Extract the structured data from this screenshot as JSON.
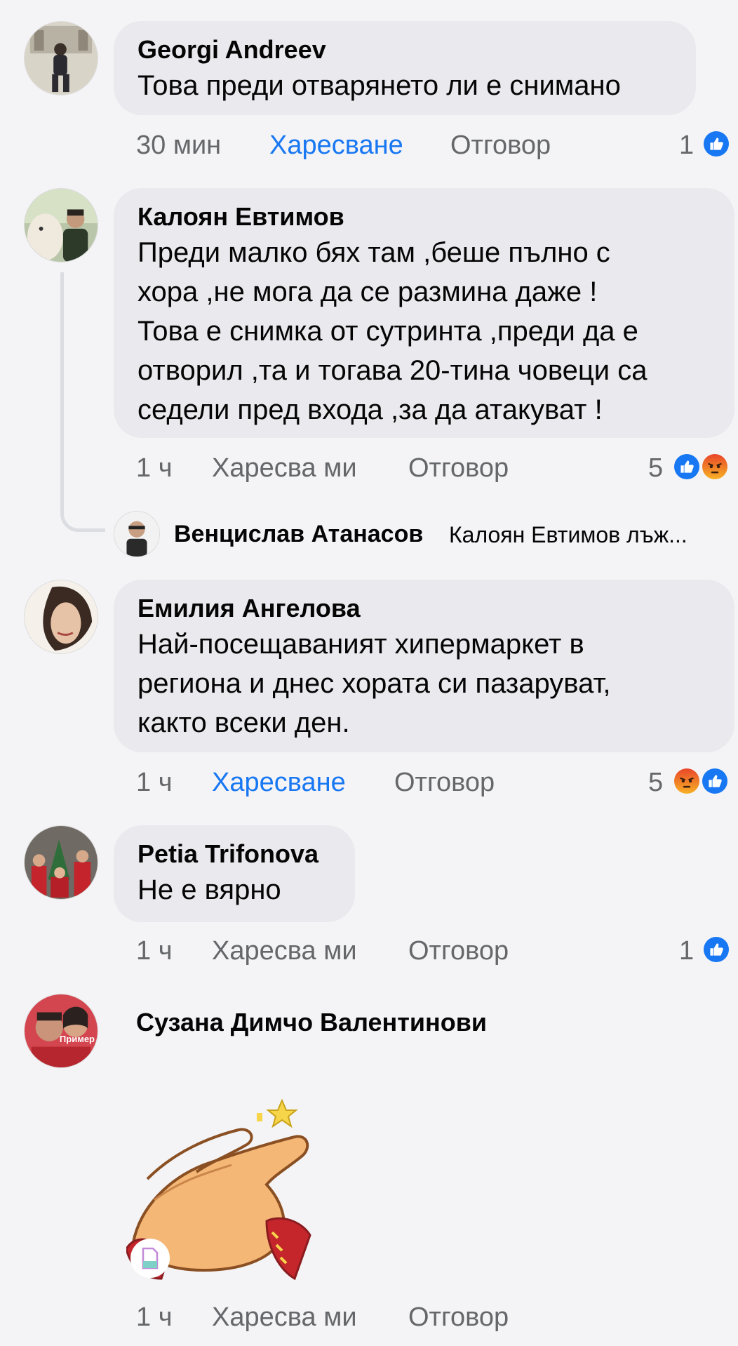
{
  "comments": [
    {
      "author": "Georgi Andreev",
      "text": "Това преди отварянето ли е снимано",
      "time": "30 мин",
      "like": "Харесване",
      "reply": "Отговор",
      "reaction_count": "1",
      "reactions": [
        "like-icon"
      ]
    },
    {
      "author": "Калоян Евтимов",
      "text_lines": [
        "Преди малко бях там ,беше пълно с",
        "хора ,не мога да се размина даже !",
        "Това е снимка от сутринта ,преди да е",
        "отворил ,та и тогава 20-тина човеци са",
        "седели пред входа ,за да атакуват !"
      ],
      "time": "1 ч",
      "like": "Харесва ми",
      "reply": "Отговор",
      "reaction_count": "5",
      "reactions": [
        "like-icon",
        "angry-icon"
      ],
      "reply_preview": {
        "author": "Венцислав Атанасов",
        "text": "Калоян Евтимов лъж..."
      }
    },
    {
      "author": "Емилия Ангелова",
      "text_lines": [
        "Най-посещаваният хипермаркет в",
        "региона и днес хората си пазаруват,",
        "както всеки ден."
      ],
      "time": "1 ч",
      "like": "Харесване",
      "reply": "Отговор",
      "reaction_count": "5",
      "reactions": [
        "angry-icon",
        "like-icon"
      ]
    },
    {
      "author": "Petia Trifonova",
      "text": "Не е вярно",
      "time": "1 ч",
      "like": "Харесва ми",
      "reply": "Отговор",
      "reaction_count": "1",
      "reactions": [
        "like-icon"
      ]
    },
    {
      "author": "Сузана Димчо Валентинови",
      "avatar_overlay": "Пример",
      "sticker": "clapping-hands-sticker",
      "time": "1 ч",
      "like": "Харесва ми",
      "reply": "Отговор"
    }
  ],
  "colors": {
    "background": "#f4f4f6",
    "bubble": "#e9e9ee",
    "meta_text": "#65676b",
    "liked_blue": "#1877f2",
    "like_reaction": "#1877f2",
    "angry_reaction": "#f0612b"
  }
}
